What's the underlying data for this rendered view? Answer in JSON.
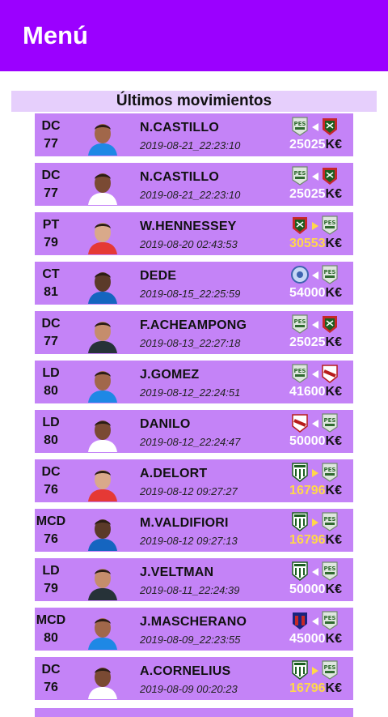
{
  "app": {
    "title": "Menú"
  },
  "section_title": "Últimos movimientos",
  "colors": {
    "accent": "#9b00ff",
    "row": "#c483f7",
    "header_bg": "#e6cffc",
    "price_highlight": "#ffd84a"
  },
  "currency_suffix": "K€",
  "moves": [
    {
      "pos": "DC",
      "rating": "77",
      "name": "N.CASTILLO",
      "date": "2019-08-21_22:23:10",
      "price": "25025",
      "from": "pes-liga",
      "to": "red-black-club",
      "dir": "left",
      "highlight": false
    },
    {
      "pos": "DC",
      "rating": "77",
      "name": "N.CASTILLO",
      "date": "2019-08-21_22:23:10",
      "price": "25025",
      "from": "pes-liga",
      "to": "red-black-club",
      "dir": "left",
      "highlight": false
    },
    {
      "pos": "PT",
      "rating": "79",
      "name": "W.HENNESSEY",
      "date": "2019-08-20 02:43:53",
      "price": "30553",
      "from": "red-black-club",
      "to": "pes-liga",
      "dir": "right",
      "highlight": true
    },
    {
      "pos": "CT",
      "rating": "81",
      "name": "DEDE",
      "date": "2019-08-15_22:25:59",
      "price": "54000",
      "from": "blue-round-club",
      "to": "pes-liga",
      "dir": "left",
      "highlight": false
    },
    {
      "pos": "DC",
      "rating": "77",
      "name": "F.ACHEAMPONG",
      "date": "2019-08-13_22:27:18",
      "price": "25025",
      "from": "pes-liga",
      "to": "red-black-club",
      "dir": "left",
      "highlight": false
    },
    {
      "pos": "LD",
      "rating": "80",
      "name": "J.GOMEZ",
      "date": "2019-08-12_22:24:51",
      "price": "41600",
      "from": "pes-liga",
      "to": "white-red-club",
      "dir": "left",
      "highlight": false
    },
    {
      "pos": "LD",
      "rating": "80",
      "name": "DANILO",
      "date": "2019-08-12_22:24:47",
      "price": "50000",
      "from": "white-red-club",
      "to": "pes-liga",
      "dir": "left",
      "highlight": false
    },
    {
      "pos": "DC",
      "rating": "76",
      "name": "A.DELORT",
      "date": "2019-08-12 09:27:27",
      "price": "16796",
      "from": "green-striped-club",
      "to": "pes-liga",
      "dir": "right",
      "highlight": true
    },
    {
      "pos": "MCD",
      "rating": "76",
      "name": "M.VALDIFIORI",
      "date": "2019-08-12 09:27:13",
      "price": "16796",
      "from": "green-striped-club",
      "to": "pes-liga",
      "dir": "right",
      "highlight": true
    },
    {
      "pos": "LD",
      "rating": "79",
      "name": "J.VELTMAN",
      "date": "2019-08-11_22:24:39",
      "price": "50000",
      "from": "green-striped-club",
      "to": "pes-liga",
      "dir": "left",
      "highlight": false
    },
    {
      "pos": "MCD",
      "rating": "80",
      "name": "J.MASCHERANO",
      "date": "2019-08-09_22:23:55",
      "price": "45000",
      "from": "blue-red-club",
      "to": "pes-liga",
      "dir": "left",
      "highlight": false
    },
    {
      "pos": "DC",
      "rating": "76",
      "name": "A.CORNELIUS",
      "date": "2019-08-09 00:20:23",
      "price": "16796",
      "from": "green-striped-club",
      "to": "pes-liga",
      "dir": "right",
      "highlight": true
    }
  ]
}
